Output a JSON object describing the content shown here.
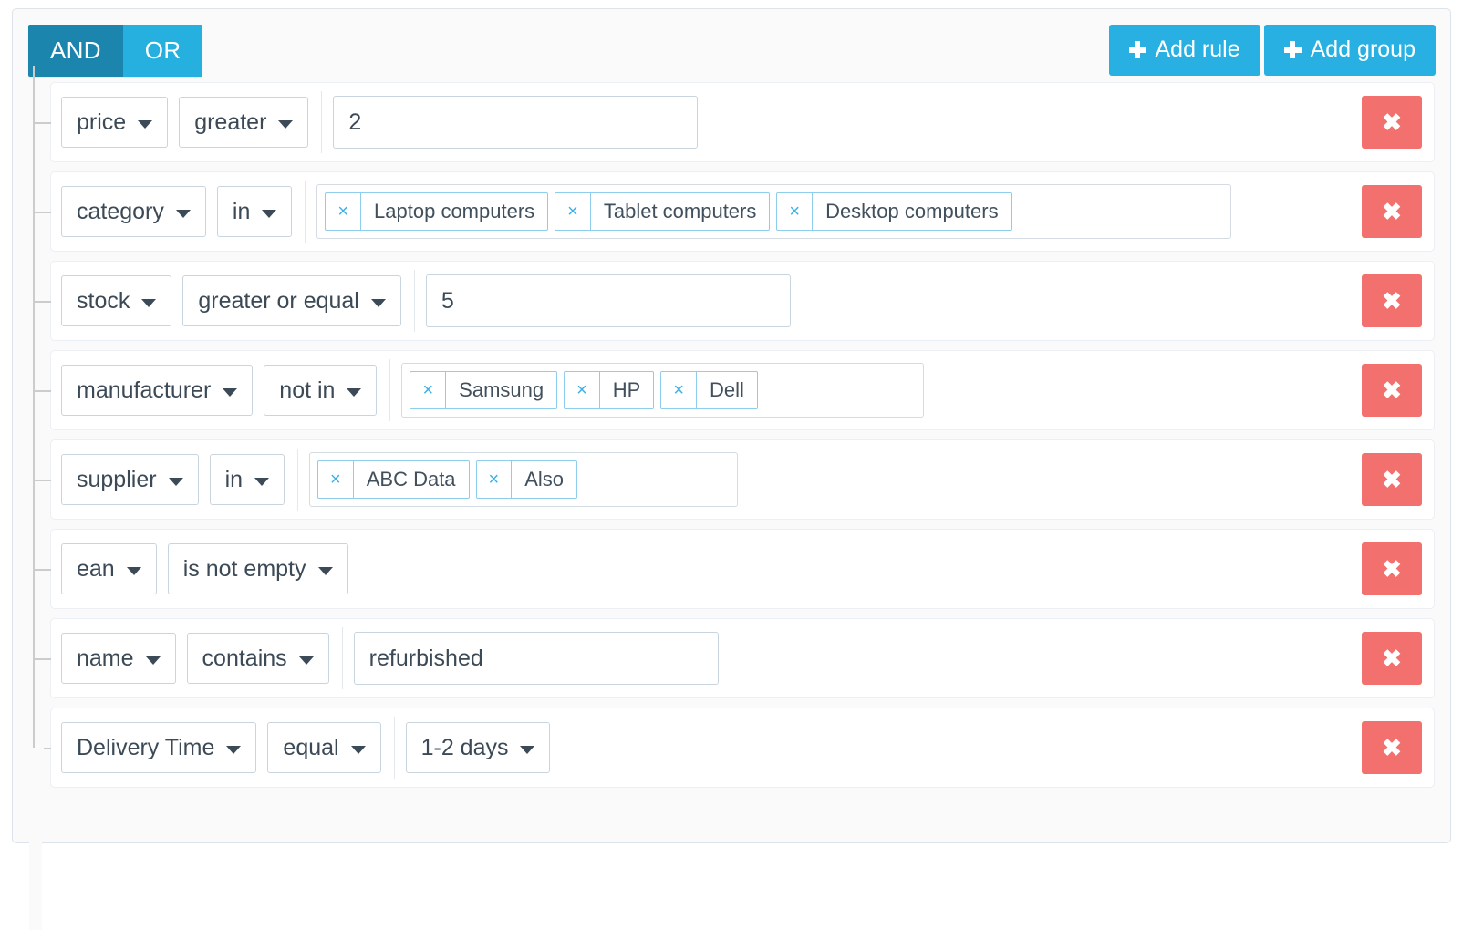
{
  "condition": {
    "options": [
      "AND",
      "OR"
    ],
    "selected": "AND",
    "and_label": "AND",
    "or_label": "OR"
  },
  "header": {
    "add_rule_label": "Add rule",
    "add_group_label": "Add group",
    "add_icon": "plus-icon"
  },
  "colors": {
    "condition_active": "#1b85ad",
    "condition_inactive": "#25b0e0",
    "add_button": "#29b0e3",
    "delete_button": "#f2706e",
    "tag_border": "#8ecdec",
    "tag_x": "#3bb0e5",
    "container_bg": "#fafafa"
  },
  "delete_icon": "✖",
  "rules": [
    {
      "field": "price",
      "operator": "greater",
      "value_type": "text",
      "value": "2",
      "value_width": 400
    },
    {
      "field": "category",
      "operator": "in",
      "value_type": "tags",
      "tags": [
        "Laptop computers",
        "Tablet computers",
        "Desktop computers"
      ],
      "value_width": 1003
    },
    {
      "field": "stock",
      "operator": "greater or equal",
      "value_type": "text",
      "value": "5",
      "value_width": 400
    },
    {
      "field": "manufacturer",
      "operator": "not in",
      "value_type": "tags",
      "tags": [
        "Samsung",
        "HP",
        "Dell"
      ],
      "value_width": 573
    },
    {
      "field": "supplier",
      "operator": "in",
      "value_type": "tags",
      "tags": [
        "ABC Data",
        "Also"
      ],
      "value_width": 470
    },
    {
      "field": "ean",
      "operator": "is not empty",
      "value_type": "none"
    },
    {
      "field": "name",
      "operator": "contains",
      "value_type": "text",
      "value": "refurbished",
      "value_width": 400
    },
    {
      "field": "Delivery Time",
      "operator": "equal",
      "value_type": "select",
      "value": "1-2 days"
    }
  ]
}
